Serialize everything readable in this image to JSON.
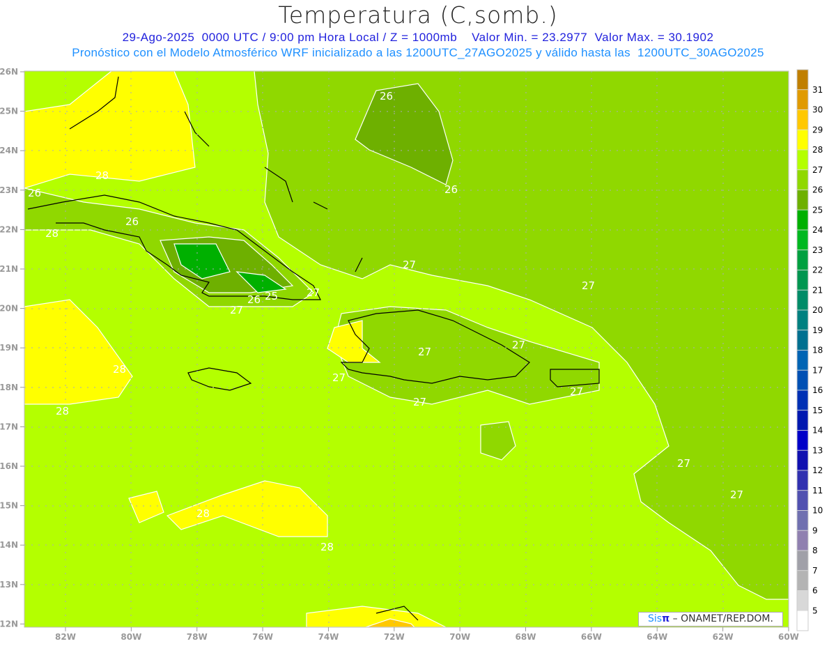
{
  "header": {
    "title": "Temperatura (C,somb.)",
    "subtitle1": "29-Ago-2025  0000 UTC / 9:00 pm Hora Local / Z = 1000mb    Valor Min. = 23.2977  Valor Max. = 30.1902",
    "subtitle2": "Pronóstico con el Modelo Atmosférico WRF inicializado a las 1200UTC_27AGO2025 y válido hasta las  1200UTC_30AGO2025"
  },
  "map": {
    "lat_labels": [
      "26N",
      "25N",
      "24N",
      "23N",
      "22N",
      "21N",
      "20N",
      "19N",
      "18N",
      "17N",
      "16N",
      "15N",
      "14N",
      "13N",
      "12N"
    ],
    "lon_labels": [
      "82W",
      "80W",
      "78W",
      "76W",
      "74W",
      "72W",
      "70W",
      "68W",
      "66W",
      "64W",
      "62W",
      "60W"
    ],
    "contour_labels": [
      "26",
      "26",
      "28",
      "26",
      "28",
      "26",
      "27",
      "27",
      "26",
      "25",
      "27",
      "27",
      "27",
      "27",
      "27",
      "27",
      "27",
      "28",
      "28",
      "27",
      "27",
      "28",
      "28"
    ],
    "colors": {
      "c27": "#b4ff00",
      "c26": "#90d800",
      "c25": "#6eb000",
      "c24": "#00b000",
      "c28": "#ffff00",
      "c29": "#ffc800"
    }
  },
  "colorbar": {
    "labels": [
      "31",
      "30",
      "29",
      "28",
      "27",
      "26",
      "25",
      "24",
      "23",
      "22",
      "21",
      "20",
      "19",
      "18",
      "17",
      "16",
      "15",
      "14",
      "13",
      "12",
      "11",
      "10",
      "9",
      "8",
      "7",
      "6",
      "5"
    ],
    "colors": [
      "#c07f00",
      "#e09a00",
      "#ffc800",
      "#ffff00",
      "#b4ff00",
      "#90d800",
      "#6eb000",
      "#00b000",
      "#00b820",
      "#00a040",
      "#009650",
      "#008c68",
      "#008080",
      "#007090",
      "#0064b4",
      "#0050b4",
      "#0030b4",
      "#0018b0",
      "#0000c8",
      "#1010b0",
      "#3030b0",
      "#5050b0",
      "#7070b0",
      "#9080b0",
      "#a0a0a8",
      "#b4b4b4",
      "#d8d8d8",
      "#ffffff"
    ]
  },
  "credit": {
    "sis": "Sis",
    "pi": "π",
    "text": " – ONAMET/REP.DOM."
  }
}
